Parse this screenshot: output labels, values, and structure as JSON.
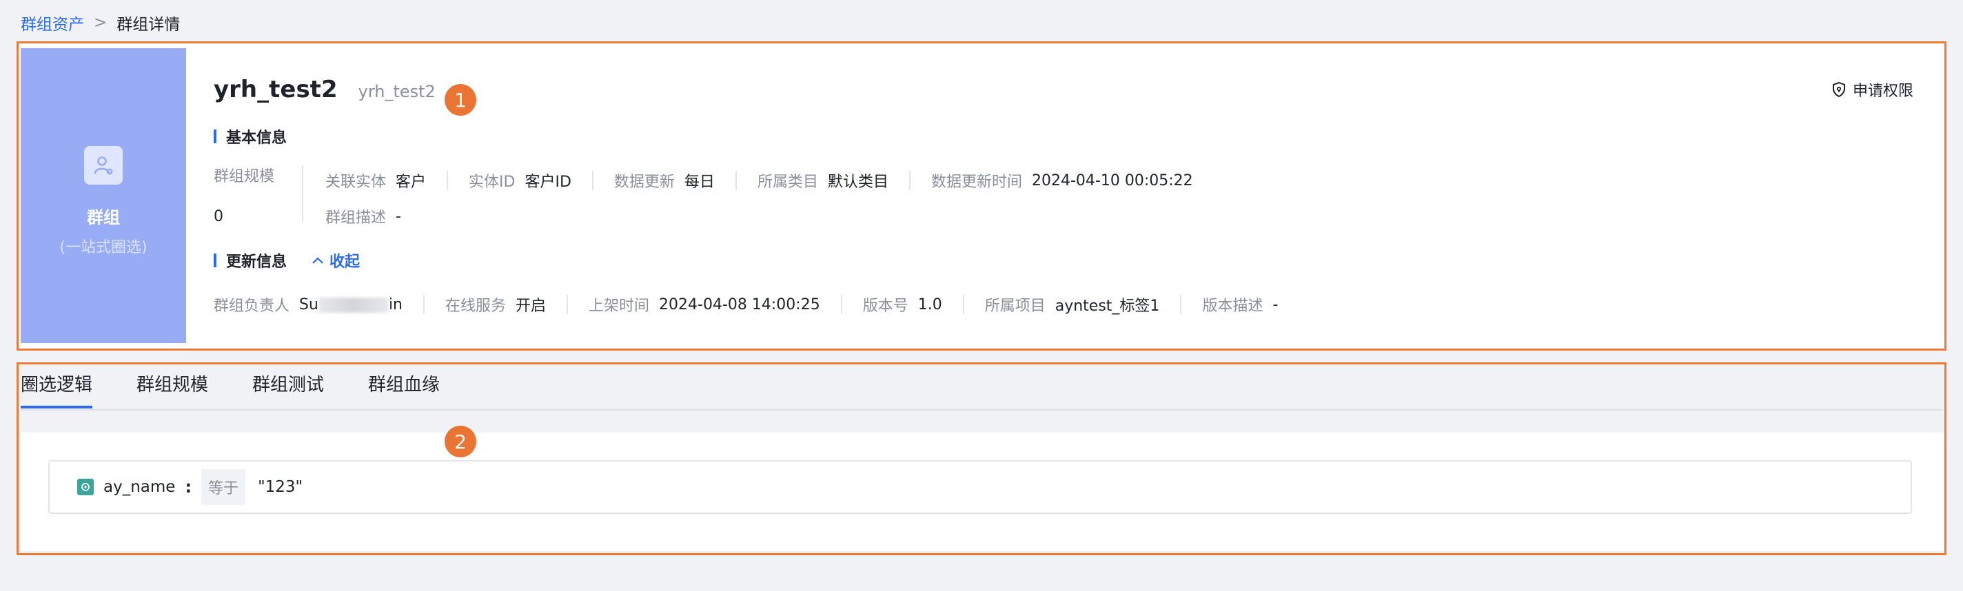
{
  "breadcrumb": {
    "parent": "群组资产",
    "separator": ">",
    "current": "群组详情"
  },
  "cover": {
    "title": "群组",
    "subtitle": "(一站式圈选)"
  },
  "header": {
    "title": "yrh_test2",
    "alias": "yrh_test2",
    "apply_label": "申请权限"
  },
  "badges": {
    "one": "1",
    "two": "2"
  },
  "basic": {
    "section_title": "基本信息",
    "scale_label": "群组规模",
    "scale_value": "0",
    "entity_label": "关联实体",
    "entity_value": "客户",
    "entity_id_label": "实体ID",
    "entity_id_value": "客户ID",
    "data_update_label": "数据更新",
    "data_update_value": "每日",
    "category_label": "所属类目",
    "category_value": "默认类目",
    "update_time_label": "数据更新时间",
    "update_time_value": "2024-04-10 00:05:22",
    "desc_label": "群组描述",
    "desc_value": "-"
  },
  "update": {
    "section_title": "更新信息",
    "collapse_label": "收起",
    "owner_label": "群组负责人",
    "owner_value_prefix": "Su",
    "owner_value_suffix": "in",
    "online_label": "在线服务",
    "online_value": "开启",
    "publish_label": "上架时间",
    "publish_value": "2024-04-08 14:00:25",
    "version_label": "版本号",
    "version_value": "1.0",
    "project_label": "所属项目",
    "project_value": "ayntest_标签1",
    "version_desc_label": "版本描述",
    "version_desc_value": "-"
  },
  "tabs": [
    {
      "label": "圈选逻辑",
      "active": true
    },
    {
      "label": "群组规模"
    },
    {
      "label": "群组测试"
    },
    {
      "label": "群组血缘"
    }
  ],
  "condition": {
    "field": "ay_name",
    "colon": ":",
    "operator": "等于",
    "value": "\"123\""
  },
  "colors": {
    "accent": "#2f6bed",
    "cover": "#97acf5",
    "frame": "#ee7a35",
    "badge": "#ea7433",
    "cond_icon": "#3aa59a"
  }
}
